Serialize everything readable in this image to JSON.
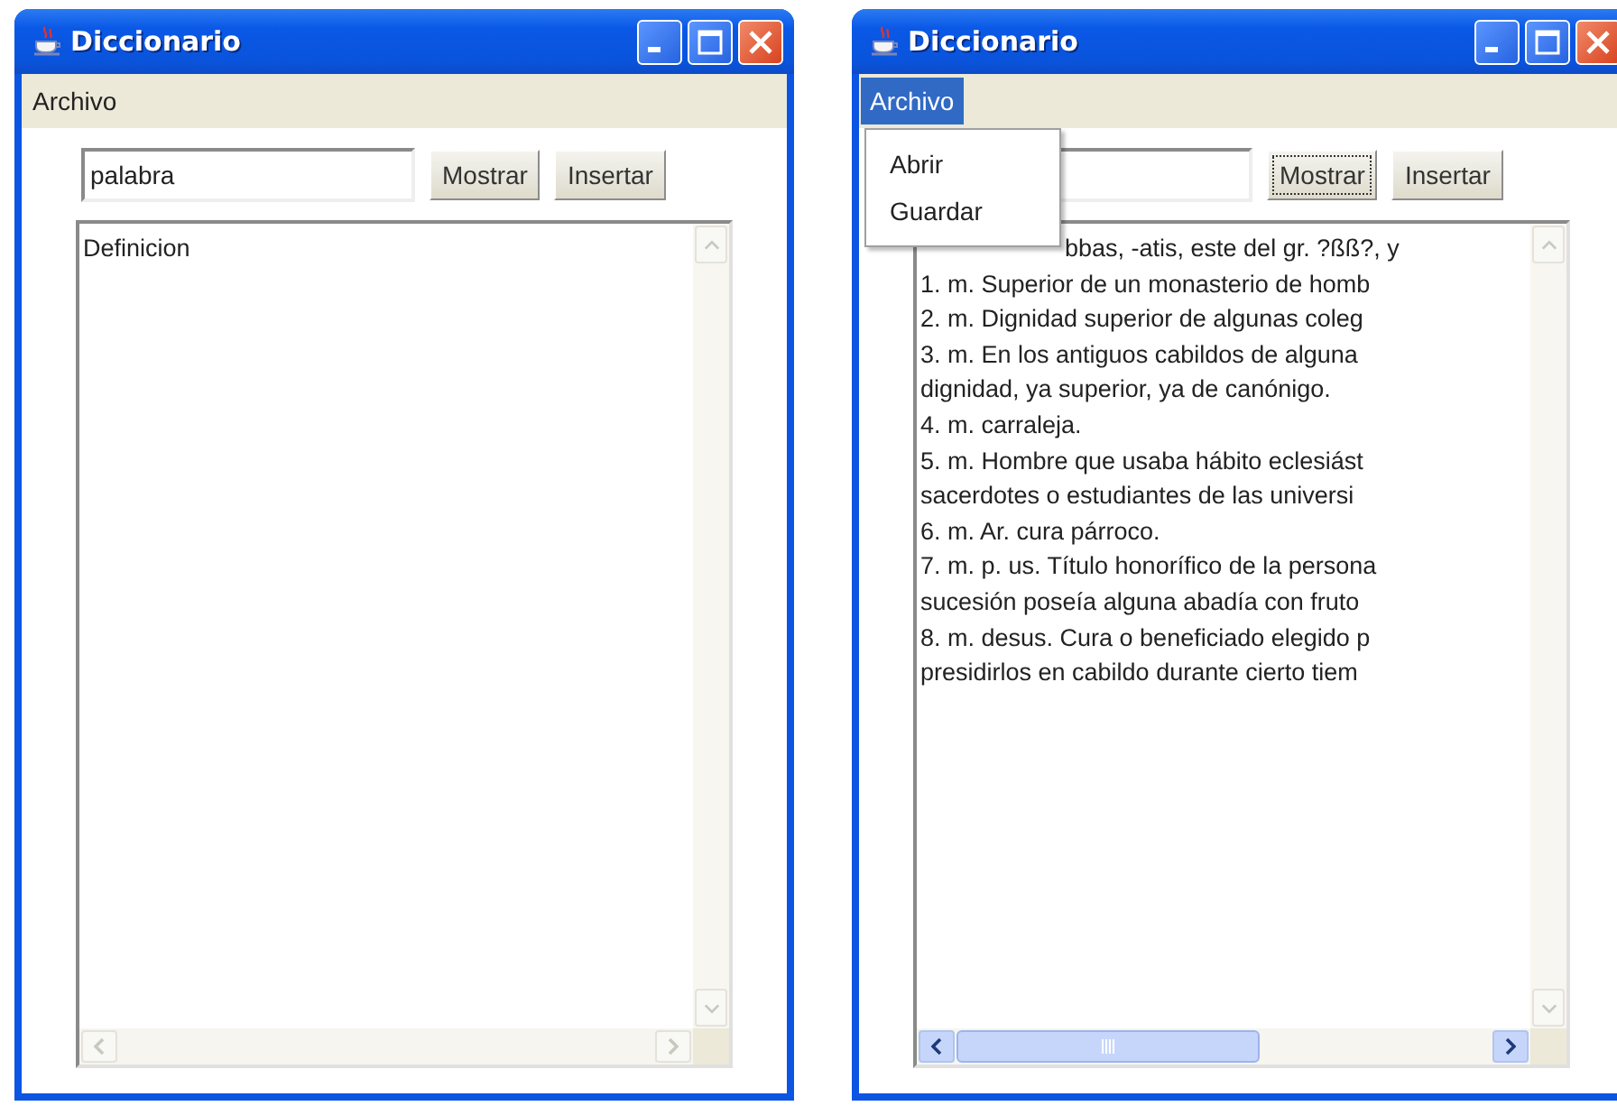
{
  "windows": [
    {
      "title": "Diccionario",
      "menu": [
        {
          "label": "Archivo",
          "selected": false
        }
      ],
      "field": {
        "value": "palabra"
      },
      "buttons": [
        {
          "label": "Mostrar",
          "focused": false
        },
        {
          "label": "Insertar",
          "focused": false
        }
      ],
      "text_lines": [
        "Definicion"
      ],
      "horizontal_scrollbar": {
        "disabled": true
      }
    },
    {
      "title": "Diccionario",
      "menu": [
        {
          "label": "Archivo",
          "selected": true,
          "items": [
            "Abrir",
            "Guardar"
          ]
        }
      ],
      "buttons": [
        {
          "label": "Mostrar",
          "focused": true
        },
        {
          "label": "Insertar",
          "focused": false
        }
      ],
      "text_lines": [
        "bbas, -atis, este del gr. ?ßß?, y",
        "1. m. Superior de un monasterio de homb",
        "2. m. Dignidad superior de algunas coleg",
        "3. m. En los antiguos cabildos de alguna",
        "dignidad, ya superior, ya de canónigo.",
        "4. m. carraleja.",
        "5. m. Hombre que usaba hábito eclesiást",
        "sacerdotes o estudiantes de las universi",
        "6. m. Ar. cura párroco.",
        "7. m. p. us. Título honorífico de la persona",
        "sucesión poseía alguna abadía con fruto",
        "8. m. desus. Cura o beneficiado elegido p",
        "presidirlos en cabildo durante cierto tiem"
      ],
      "horizontal_scrollbar": {
        "disabled": false
      }
    }
  ]
}
